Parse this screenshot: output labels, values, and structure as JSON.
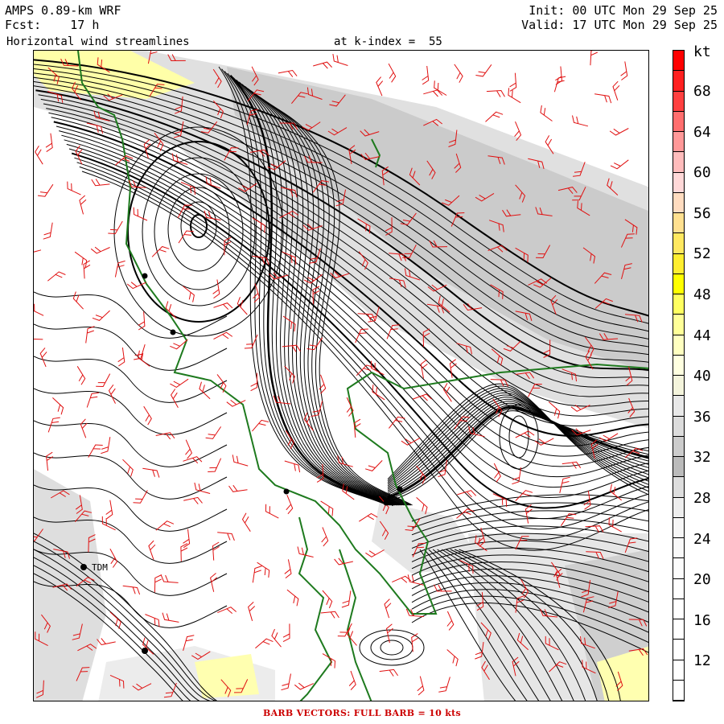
{
  "header": {
    "model": "AMPS 0.89-km WRF",
    "forecast": "Fcst:    17 h",
    "field": "Horizontal wind streamlines",
    "level": "at k-index =  55",
    "init": "Init: 00 UTC Mon 29 Sep 25",
    "valid": "Valid: 17 UTC Mon 29 Sep 25"
  },
  "colorbar": {
    "unit": "kt",
    "labels": [
      "68",
      "64",
      "60",
      "56",
      "52",
      "48",
      "44",
      "40",
      "36",
      "32",
      "28",
      "24",
      "20",
      "16",
      "12"
    ],
    "colors": [
      "#ff0000",
      "#ff2020",
      "#ff4040",
      "#ff6e6e",
      "#ff9898",
      "#ffbcbc",
      "#ffd8d8",
      "#ffdcc0",
      "#ffe090",
      "#ffe860",
      "#ffee30",
      "#ffff00",
      "#ffff60",
      "#ffff98",
      "#ffffc0",
      "#ffffe0",
      "#f4f4dc",
      "#e8e8e8",
      "#dcdcdc",
      "#cccccc",
      "#bbbbbb",
      "#dddddd",
      "#eeeeee",
      "#f6f6f6",
      "#f9f9f9",
      "#fcfcfc",
      "#fefefe",
      "#ffffff",
      "#ffffff",
      "#ffffff",
      "#ffffff",
      "#ffffff"
    ]
  },
  "map": {
    "stations": [
      {
        "name": "TDM"
      }
    ],
    "streamline_color": "#000000",
    "coast_color": "#1e7a1e",
    "barb_color": "#e01010"
  },
  "footer": "BARB VECTORS:  FULL BARB = 10 kts"
}
